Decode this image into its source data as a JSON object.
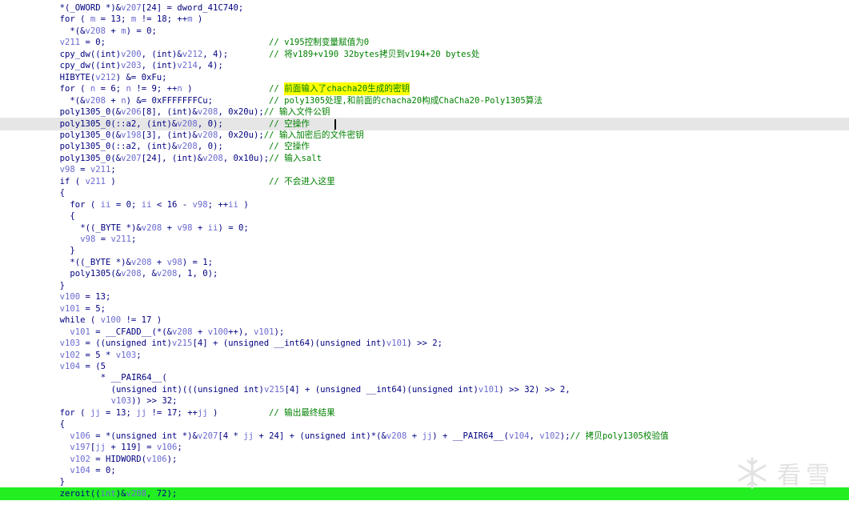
{
  "watermark": {
    "text": "看雪",
    "icon": "snowflake-icon"
  },
  "lines": [
    {
      "indent": 4,
      "segs": [
        [
          "k",
          "*(_OWORD *)&"
        ],
        [
          "v",
          "v207"
        ],
        [
          "k",
          "[24] = dword_41C740;"
        ]
      ]
    },
    {
      "indent": 4,
      "segs": [
        [
          "k",
          "for ( "
        ],
        [
          "v",
          "m"
        ],
        [
          "k",
          " = 13; "
        ],
        [
          "v",
          "m"
        ],
        [
          "k",
          " != 18; ++"
        ],
        [
          "v",
          "m"
        ],
        [
          "k",
          " )"
        ]
      ]
    },
    {
      "indent": 6,
      "segs": [
        [
          "k",
          "*(&"
        ],
        [
          "v",
          "v208"
        ],
        [
          "k",
          " + "
        ],
        [
          "v",
          "m"
        ],
        [
          "k",
          ") = 0;"
        ]
      ]
    },
    {
      "indent": 4,
      "segs": [
        [
          "v",
          "v211"
        ],
        [
          "k",
          " = 0;"
        ]
      ],
      "comment": "// v195控制变量赋值为0"
    },
    {
      "indent": 4,
      "segs": [
        [
          "k",
          "cpy_dw((int)"
        ],
        [
          "v",
          "v200"
        ],
        [
          "k",
          ", (int)&"
        ],
        [
          "v",
          "v212"
        ],
        [
          "k",
          ", 4);"
        ]
      ],
      "comment": "// 将v189+v190 32bytes拷贝到v194+20 bytes处"
    },
    {
      "indent": 4,
      "segs": [
        [
          "k",
          "cpy_dw((int)"
        ],
        [
          "v",
          "v203"
        ],
        [
          "k",
          ", (int)"
        ],
        [
          "v",
          "v214"
        ],
        [
          "k",
          ", 4);"
        ]
      ]
    },
    {
      "indent": 4,
      "segs": [
        [
          "k",
          "HIBYTE("
        ],
        [
          "v",
          "v212"
        ],
        [
          "k",
          ") &= 0xFu;"
        ]
      ]
    },
    {
      "indent": 4,
      "segs": [
        [
          "k",
          "for ( "
        ],
        [
          "v",
          "n"
        ],
        [
          "k",
          " = 6; "
        ],
        [
          "v",
          "n"
        ],
        [
          "k",
          " != 9; ++"
        ],
        [
          "v",
          "n"
        ],
        [
          "k",
          " )"
        ]
      ],
      "comment": "// ",
      "hl": "前面输入了chacha20生成的密钥"
    },
    {
      "indent": 6,
      "segs": [
        [
          "k",
          "*(&"
        ],
        [
          "v",
          "v208"
        ],
        [
          "k",
          " + "
        ],
        [
          "v",
          "n"
        ],
        [
          "k",
          ") &= 0xFFFFFFFCu;"
        ]
      ],
      "comment": "// poly1305处理,和前面的chacha20构成ChaCha20-Poly1305算法"
    },
    {
      "indent": 4,
      "segs": [
        [
          "k",
          "poly1305_0(&"
        ],
        [
          "v",
          "v206"
        ],
        [
          "k",
          "[8], (int)&"
        ],
        [
          "v",
          "v208"
        ],
        [
          "k",
          ", 0x20u);"
        ]
      ],
      "comment2": "// 输入文件公钥"
    },
    {
      "indent": 4,
      "segs": [
        [
          "k",
          "poly1305_0(::a2, (int)&"
        ],
        [
          "v",
          "v208"
        ],
        [
          "k",
          ", 0);"
        ]
      ],
      "comment": "// 空操作",
      "cursor": true,
      "style": "gray"
    },
    {
      "indent": 4,
      "segs": [
        [
          "k",
          "poly1305_0(&"
        ],
        [
          "v",
          "v198"
        ],
        [
          "k",
          "[3], (int)&"
        ],
        [
          "v",
          "v208"
        ],
        [
          "k",
          ", 0x20u);"
        ]
      ],
      "comment2": "// 输入加密后的文件密钥"
    },
    {
      "indent": 4,
      "segs": [
        [
          "k",
          "poly1305_0(::a2, (int)&"
        ],
        [
          "v",
          "v208"
        ],
        [
          "k",
          ", 0);"
        ]
      ],
      "comment": "// 空操作"
    },
    {
      "indent": 4,
      "segs": [
        [
          "k",
          "poly1305_0(&"
        ],
        [
          "v",
          "v207"
        ],
        [
          "k",
          "[24], (int)&"
        ],
        [
          "v",
          "v208"
        ],
        [
          "k",
          ", 0x10u);"
        ]
      ],
      "comment2": "// 输入salt"
    },
    {
      "indent": 4,
      "segs": [
        [
          "v",
          "v98"
        ],
        [
          "k",
          " = "
        ],
        [
          "v",
          "v211"
        ],
        [
          "k",
          ";"
        ]
      ]
    },
    {
      "indent": 4,
      "segs": [
        [
          "k",
          "if ( "
        ],
        [
          "v",
          "v211"
        ],
        [
          "k",
          " )"
        ]
      ],
      "comment": "// 不会进入这里"
    },
    {
      "indent": 4,
      "segs": [
        [
          "k",
          "{"
        ]
      ]
    },
    {
      "indent": 6,
      "segs": [
        [
          "k",
          "for ( "
        ],
        [
          "v",
          "ii"
        ],
        [
          "k",
          " = 0; "
        ],
        [
          "v",
          "ii"
        ],
        [
          "k",
          " < 16 - "
        ],
        [
          "v",
          "v98"
        ],
        [
          "k",
          "; ++"
        ],
        [
          "v",
          "ii"
        ],
        [
          "k",
          " )"
        ]
      ]
    },
    {
      "indent": 6,
      "segs": [
        [
          "k",
          "{"
        ]
      ]
    },
    {
      "indent": 8,
      "segs": [
        [
          "k",
          "*((_BYTE *)&"
        ],
        [
          "v",
          "v208"
        ],
        [
          "k",
          " + "
        ],
        [
          "v",
          "v98"
        ],
        [
          "k",
          " + "
        ],
        [
          "v",
          "ii"
        ],
        [
          "k",
          ") = 0;"
        ]
      ]
    },
    {
      "indent": 8,
      "segs": [
        [
          "v",
          "v98"
        ],
        [
          "k",
          " = "
        ],
        [
          "v",
          "v211"
        ],
        [
          "k",
          ";"
        ]
      ]
    },
    {
      "indent": 6,
      "segs": [
        [
          "k",
          "}"
        ]
      ]
    },
    {
      "indent": 6,
      "segs": [
        [
          "k",
          "*((_BYTE *)&"
        ],
        [
          "v",
          "v208"
        ],
        [
          "k",
          " + "
        ],
        [
          "v",
          "v98"
        ],
        [
          "k",
          ") = 1;"
        ]
      ]
    },
    {
      "indent": 6,
      "segs": [
        [
          "k",
          "poly1305(&"
        ],
        [
          "v",
          "v208"
        ],
        [
          "k",
          ", &"
        ],
        [
          "v",
          "v208"
        ],
        [
          "k",
          ", 1, 0);"
        ]
      ]
    },
    {
      "indent": 4,
      "segs": [
        [
          "k",
          "}"
        ]
      ]
    },
    {
      "indent": 4,
      "segs": [
        [
          "v",
          "v100"
        ],
        [
          "k",
          " = 13;"
        ]
      ]
    },
    {
      "indent": 4,
      "segs": [
        [
          "v",
          "v101"
        ],
        [
          "k",
          " = 5;"
        ]
      ]
    },
    {
      "indent": 4,
      "segs": [
        [
          "k",
          "while ( "
        ],
        [
          "v",
          "v100"
        ],
        [
          "k",
          " != 17 )"
        ]
      ]
    },
    {
      "indent": 6,
      "segs": [
        [
          "v",
          "v101"
        ],
        [
          "k",
          " = __CFADD__(*(&"
        ],
        [
          "v",
          "v208"
        ],
        [
          "k",
          " + "
        ],
        [
          "v",
          "v100"
        ],
        [
          "k",
          "++), "
        ],
        [
          "v",
          "v101"
        ],
        [
          "k",
          ");"
        ]
      ]
    },
    {
      "indent": 4,
      "segs": [
        [
          "v",
          "v103"
        ],
        [
          "k",
          " = ((unsigned int)"
        ],
        [
          "v",
          "v215"
        ],
        [
          "k",
          "[4] + (unsigned __int64)(unsigned int)"
        ],
        [
          "v",
          "v101"
        ],
        [
          "k",
          ") >> 2;"
        ]
      ]
    },
    {
      "indent": 4,
      "segs": [
        [
          "v",
          "v102"
        ],
        [
          "k",
          " = 5 * "
        ],
        [
          "v",
          "v103"
        ],
        [
          "k",
          ";"
        ]
      ]
    },
    {
      "indent": 4,
      "segs": [
        [
          "v",
          "v104"
        ],
        [
          "k",
          " = (5"
        ]
      ]
    },
    {
      "indent": 12,
      "segs": [
        [
          "k",
          "* __PAIR64__("
        ]
      ]
    },
    {
      "indent": 14,
      "segs": [
        [
          "k",
          "(unsigned int)(((unsigned int)"
        ],
        [
          "v",
          "v215"
        ],
        [
          "k",
          "[4] + (unsigned __int64)(unsigned int)"
        ],
        [
          "v",
          "v101"
        ],
        [
          "k",
          ") >> 32) >> 2,"
        ]
      ]
    },
    {
      "indent": 14,
      "segs": [
        [
          "v",
          "v103"
        ],
        [
          "k",
          ")) >> 32;"
        ]
      ]
    },
    {
      "indent": 4,
      "segs": [
        [
          "k",
          "for ( "
        ],
        [
          "v",
          "jj"
        ],
        [
          "k",
          " = 13; "
        ],
        [
          "v",
          "jj"
        ],
        [
          "k",
          " != 17; ++"
        ],
        [
          "v",
          "jj"
        ],
        [
          "k",
          " )"
        ]
      ],
      "comment": "// 输出最终结果"
    },
    {
      "indent": 4,
      "segs": [
        [
          "k",
          "{"
        ]
      ]
    },
    {
      "indent": 6,
      "segs": [
        [
          "v",
          "v106"
        ],
        [
          "k",
          " = *(unsigned int *)&"
        ],
        [
          "v",
          "v207"
        ],
        [
          "k",
          "[4 * "
        ],
        [
          "v",
          "jj"
        ],
        [
          "k",
          " + 24] + (unsigned int)*(&"
        ],
        [
          "v",
          "v208"
        ],
        [
          "k",
          " + "
        ],
        [
          "v",
          "jj"
        ],
        [
          "k",
          ") + __PAIR64__("
        ],
        [
          "v",
          "v104"
        ],
        [
          "k",
          ", "
        ],
        [
          "v",
          "v102"
        ],
        [
          "k",
          ");"
        ],
        [
          "c",
          "// 拷贝poly1305校验值"
        ]
      ]
    },
    {
      "indent": 6,
      "segs": [
        [
          "v",
          "v197"
        ],
        [
          "k",
          "["
        ],
        [
          "v",
          "jj"
        ],
        [
          "k",
          " + 119] = "
        ],
        [
          "v",
          "v106"
        ],
        [
          "k",
          ";"
        ]
      ]
    },
    {
      "indent": 6,
      "segs": [
        [
          "v",
          "v102"
        ],
        [
          "k",
          " = HIDWORD("
        ],
        [
          "v",
          "v106"
        ],
        [
          "k",
          ");"
        ]
      ]
    },
    {
      "indent": 6,
      "segs": [
        [
          "v",
          "v104"
        ],
        [
          "k",
          " = 0;"
        ]
      ]
    },
    {
      "indent": 4,
      "segs": [
        [
          "k",
          "}"
        ]
      ]
    },
    {
      "indent": 4,
      "segs": [
        [
          "k",
          "zeroit(("
        ],
        [
          "v",
          "int"
        ],
        [
          "k",
          ")&"
        ],
        [
          "v",
          "v208"
        ],
        [
          "k",
          ", 72);"
        ]
      ],
      "style": "green"
    }
  ]
}
